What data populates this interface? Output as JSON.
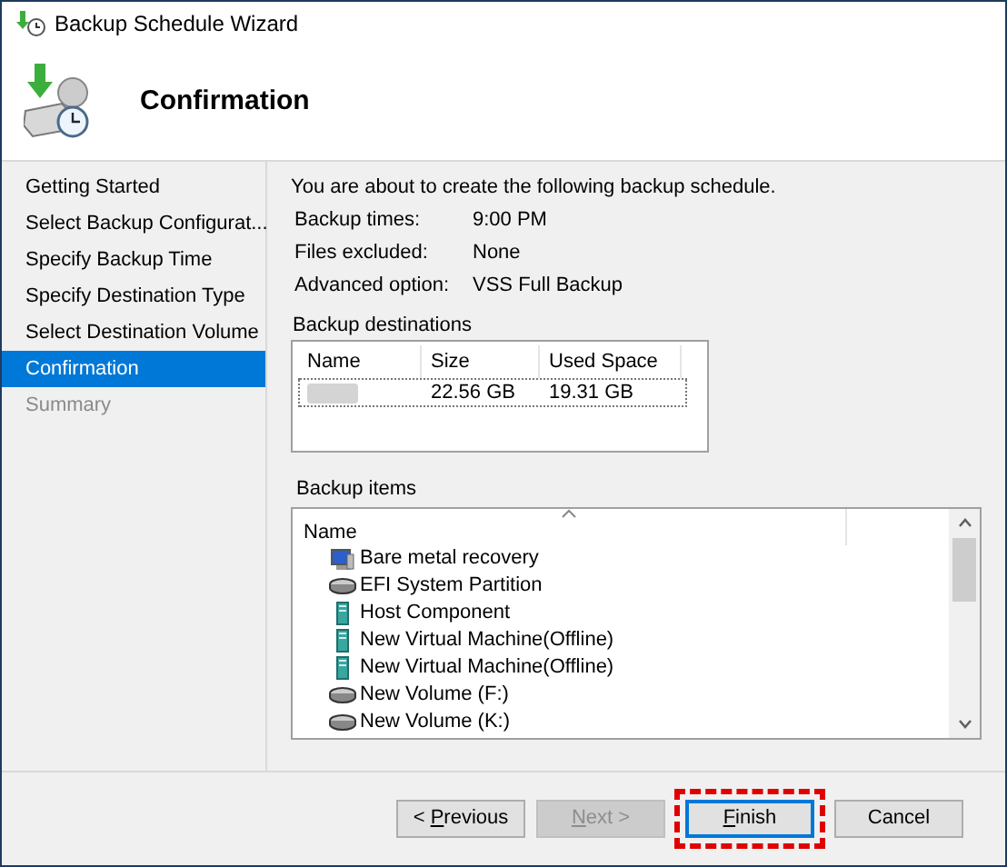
{
  "window": {
    "title": "Backup Schedule Wizard"
  },
  "header": {
    "title": "Confirmation"
  },
  "steps": [
    {
      "label": "Getting Started",
      "selected": false,
      "disabled": false
    },
    {
      "label": "Select Backup Configurat...",
      "selected": false,
      "disabled": false
    },
    {
      "label": "Specify Backup Time",
      "selected": false,
      "disabled": false
    },
    {
      "label": "Specify Destination Type",
      "selected": false,
      "disabled": false
    },
    {
      "label": "Select Destination Volume",
      "selected": false,
      "disabled": false
    },
    {
      "label": "Confirmation",
      "selected": true,
      "disabled": false
    },
    {
      "label": "Summary",
      "selected": false,
      "disabled": true
    }
  ],
  "intro": "You are about to create the following backup schedule.",
  "details": [
    {
      "label": "Backup times:",
      "value": "9:00 PM"
    },
    {
      "label": "Files excluded:",
      "value": "None"
    },
    {
      "label": "Advanced option:",
      "value": "VSS Full Backup"
    }
  ],
  "destinations": {
    "label": "Backup destinations",
    "columns": [
      "Name",
      "Size",
      "Used Space"
    ],
    "rows": [
      {
        "name_redacted": true,
        "size": "22.56 GB",
        "used_space": "19.31 GB"
      }
    ]
  },
  "items": {
    "label": "Backup items",
    "columns": [
      "Name"
    ],
    "rows": [
      {
        "kind": "system",
        "name": "Bare metal recovery"
      },
      {
        "kind": "disk",
        "name": "EFI System Partition"
      },
      {
        "kind": "vm",
        "name": "Host Component"
      },
      {
        "kind": "vm",
        "name": "New Virtual Machine(Offline)"
      },
      {
        "kind": "vm",
        "name": "New Virtual Machine(Offline)"
      },
      {
        "kind": "disk",
        "name": "New Volume (F:)"
      },
      {
        "kind": "disk",
        "name": "New Volume (K:)"
      }
    ]
  },
  "buttons": [
    {
      "before": "< ",
      "key": "P",
      "after": "revious",
      "disabled": false,
      "highlighted": false
    },
    {
      "key": "N",
      "after": "ext >",
      "disabled": true,
      "highlighted": false
    },
    {
      "key": "F",
      "after": "inish",
      "disabled": false,
      "highlighted": true
    },
    {
      "before": "Cancel",
      "disabled": false,
      "highlighted": false
    }
  ]
}
